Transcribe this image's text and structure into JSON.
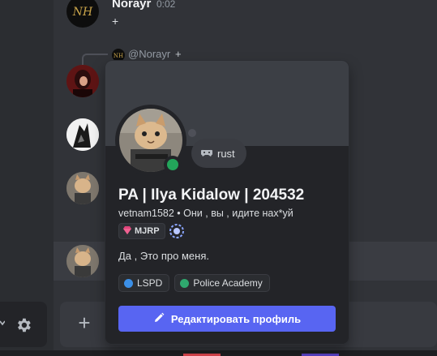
{
  "message": {
    "author": "Norayr",
    "time": "0:02",
    "text": "+"
  },
  "reply": {
    "mention": "@Norayr",
    "text": "+"
  },
  "profile": {
    "display_name": "PA | Ilya Kidalow | 204532",
    "username": "vetnam1582",
    "separator": "•",
    "custom_status": "Они , вы , идите нах*уй",
    "server_tag": "MJRP",
    "bubble_text": "rust",
    "about": "Да , Это про меня.",
    "roles": [
      {
        "name": "LSPD",
        "color": "#3b8fe6"
      },
      {
        "name": "Police Academy",
        "color": "#2fa86e"
      }
    ],
    "edit_button_label": "Редактировать профиль",
    "status": "online"
  },
  "icons": {
    "settings": "gear-icon",
    "attach": "plus-icon",
    "edit": "pencil-icon"
  },
  "colors": {
    "accent": "#5865f2",
    "online": "#23a55a"
  }
}
